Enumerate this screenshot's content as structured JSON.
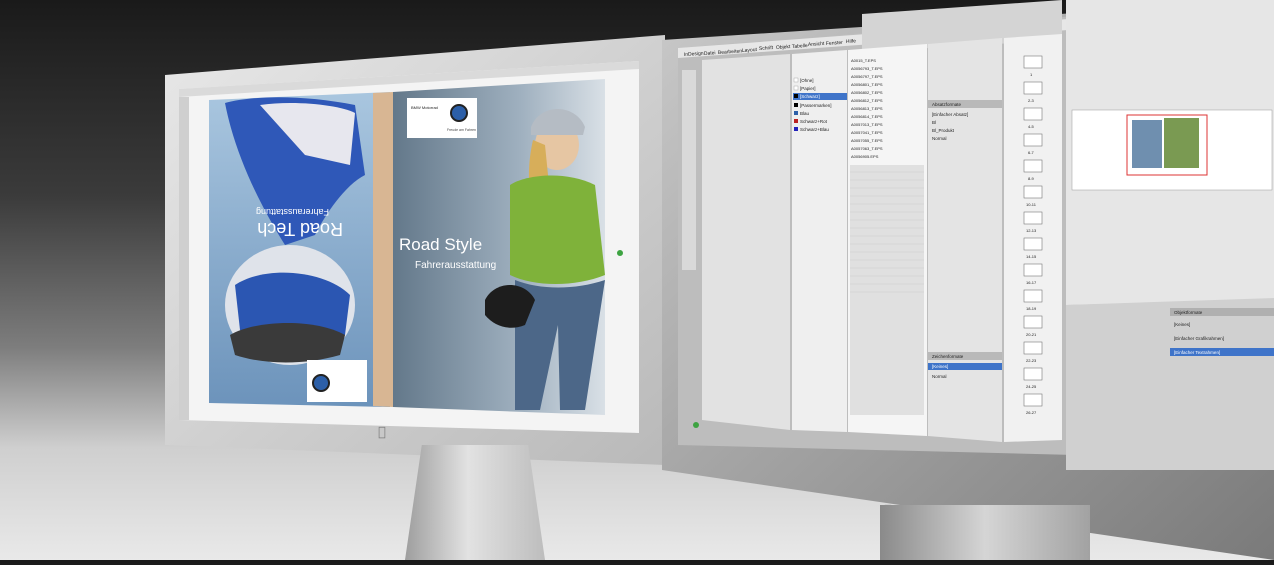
{
  "left_screen": {
    "headline": "Road Style",
    "subheadline": "Fahrerausstattung",
    "rotated_headline": "Road Tech",
    "rotated_subheadline": "Fahrerausstattung",
    "brand_label": "BMW Motorrad",
    "tagline": "Freude am Fahren"
  },
  "right_screen": {
    "menu": [
      "InDesign",
      "Datei",
      "Bearbeiten",
      "Layout",
      "Schrift",
      "Objekt",
      "Tabelle",
      "Ansicht",
      "Fenster",
      "Hilfe"
    ],
    "link_files": [
      "A0015_T.EPS",
      "A0056793_T.EPS",
      "A0056797_T.EPS",
      "A0056801_T.EPS",
      "A0056802_T.EPS",
      "A0056812_T.EPS",
      "A0056813_T.EPS",
      "A0056814_T.EPS",
      "A0057013_T.EPS",
      "A0057041_T.EPS",
      "A0057055_T.EPS",
      "A0057063_T.EPS",
      "A0056905.EPS"
    ],
    "swatch_list": [
      "[Ohne]",
      "[Papier]",
      "[Schwarz]",
      "[Passermarken]",
      "Blau",
      "Schwarz+Rot",
      "Schwarz+Blau"
    ],
    "panel_paragraph_styles": "Absatzformate",
    "paragraph_styles": [
      "[Einfacher Absatz]",
      "Bl",
      "Bl_Produkt",
      "Normal"
    ],
    "panel_character_styles": "Zeichenformate",
    "character_styles": [
      "[Keines]",
      "Normal"
    ],
    "panel_object_styles": "Objektformate",
    "object_styles": [
      "[Keines]",
      "[Einfacher Grafikrahmen]",
      "[Einfacher Textrahmen]"
    ],
    "page_numbers": [
      "1",
      "2-3",
      "4-5",
      "6-7",
      "8-9",
      "10-11",
      "12-13",
      "14-15",
      "16-17",
      "18-19",
      "20-21",
      "22-23",
      "24-25",
      "26-27"
    ]
  },
  "colors": {
    "bmw_blue": "#2c5fa8",
    "shirt_green": "#7fb23a",
    "ui_gray": "#d6d6d6",
    "selection_blue": "#3f74c9"
  }
}
